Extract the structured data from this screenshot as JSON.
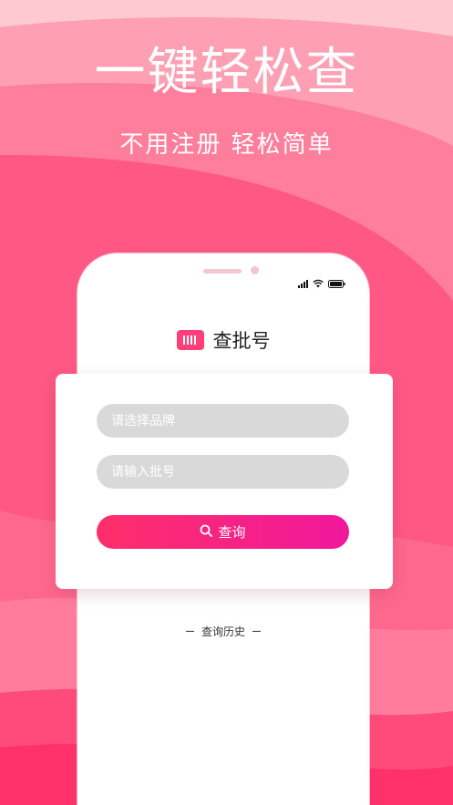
{
  "hero": {
    "headline": "一键轻松查",
    "subheadline": "不用注册  轻松简单"
  },
  "app": {
    "title": "查批号",
    "logo_icon": "barcode-icon"
  },
  "status_bar": {
    "icons": [
      "signal-icon",
      "wifi-icon",
      "battery-icon"
    ]
  },
  "form": {
    "brand_placeholder": "请选择品牌",
    "batch_placeholder": "请输入批号",
    "query_label": "查询",
    "query_icon": "search-icon"
  },
  "history": {
    "label": "查询历史"
  },
  "colors": {
    "accent": "#ff3f7a",
    "button_start": "#ff2f6a",
    "button_end": "#f0179c",
    "input_bg": "#d9d9d9"
  }
}
